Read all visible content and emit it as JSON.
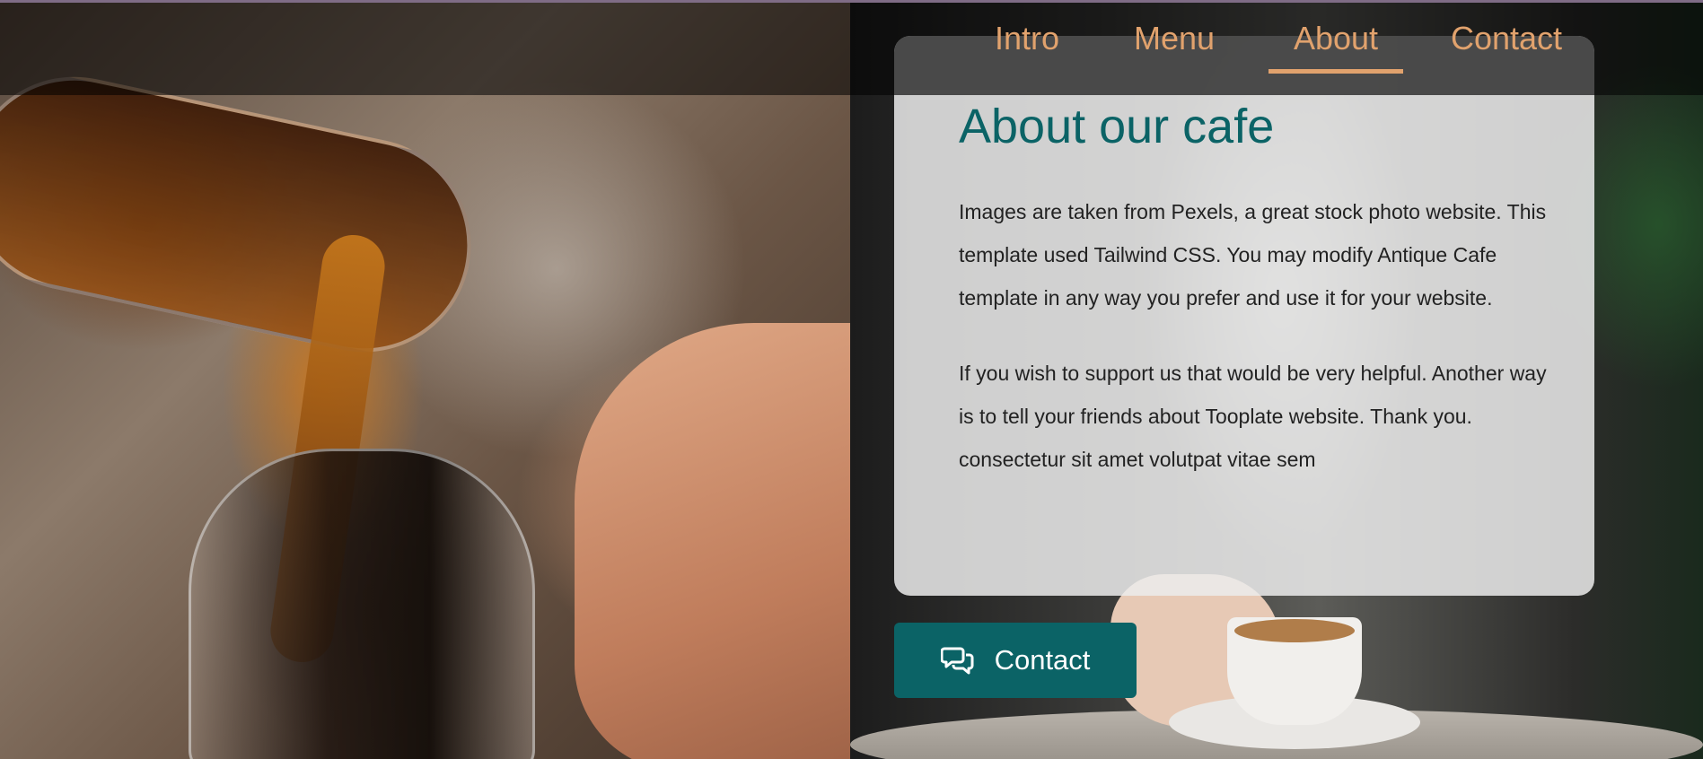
{
  "nav": {
    "items": [
      {
        "label": "Intro"
      },
      {
        "label": "Menu"
      },
      {
        "label": "About",
        "active": true
      },
      {
        "label": "Contact"
      }
    ]
  },
  "about": {
    "title": "About our cafe",
    "paragraphs": [
      "Images are taken from Pexels, a great stock photo website. This template used Tailwind CSS. You may modify Antique Cafe template in any way you prefer and use it for your website.",
      "If you wish to support us that would be very helpful. Another way is to tell your friends about Tooplate website. Thank you. consectetur sit amet volutpat vitae sem"
    ]
  },
  "contact_button": {
    "label": "Contact",
    "icon": "chat-bubbles-icon"
  },
  "colors": {
    "accent": "#e1a26d",
    "teal": "#0b6366"
  }
}
